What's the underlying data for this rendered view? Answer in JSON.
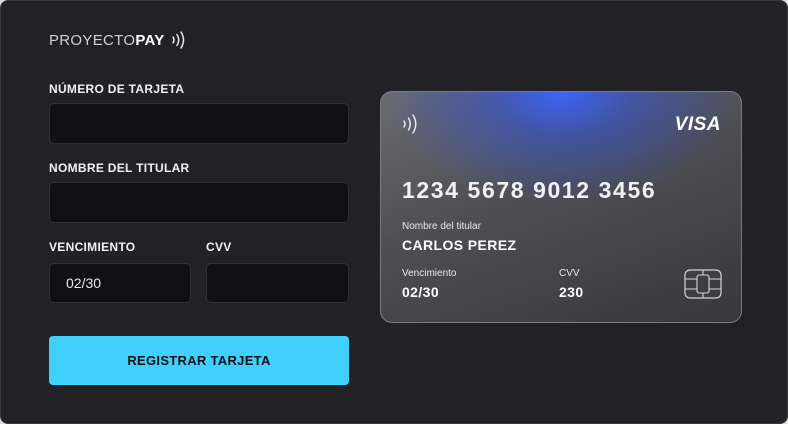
{
  "brand": {
    "light": "PROYECTO",
    "bold": "PAY",
    "icon": "contactless-icon"
  },
  "form": {
    "card_number": {
      "label": "NÚMERO DE TARJETA",
      "value": ""
    },
    "holder": {
      "label": "NOMBRE DEL TITULAR",
      "value": ""
    },
    "expiry": {
      "label": "VENCIMIENTO",
      "value": "02/30"
    },
    "cvv": {
      "label": "CVV",
      "value": ""
    },
    "submit_label": "REGISTRAR TARJETA"
  },
  "card": {
    "network": "VISA",
    "number": "1234 5678 9012 3456",
    "holder_caption": "Nombre del titular",
    "holder_name": "CARLOS PEREZ",
    "expiry_caption": "Vencimiento",
    "expiry_value": "02/30",
    "cvv_caption": "CVV",
    "cvv_value": "230"
  },
  "colors": {
    "background": "#222226",
    "field": "#111113",
    "accent": "#40d0fd",
    "card_glow": "#3a64ff"
  }
}
